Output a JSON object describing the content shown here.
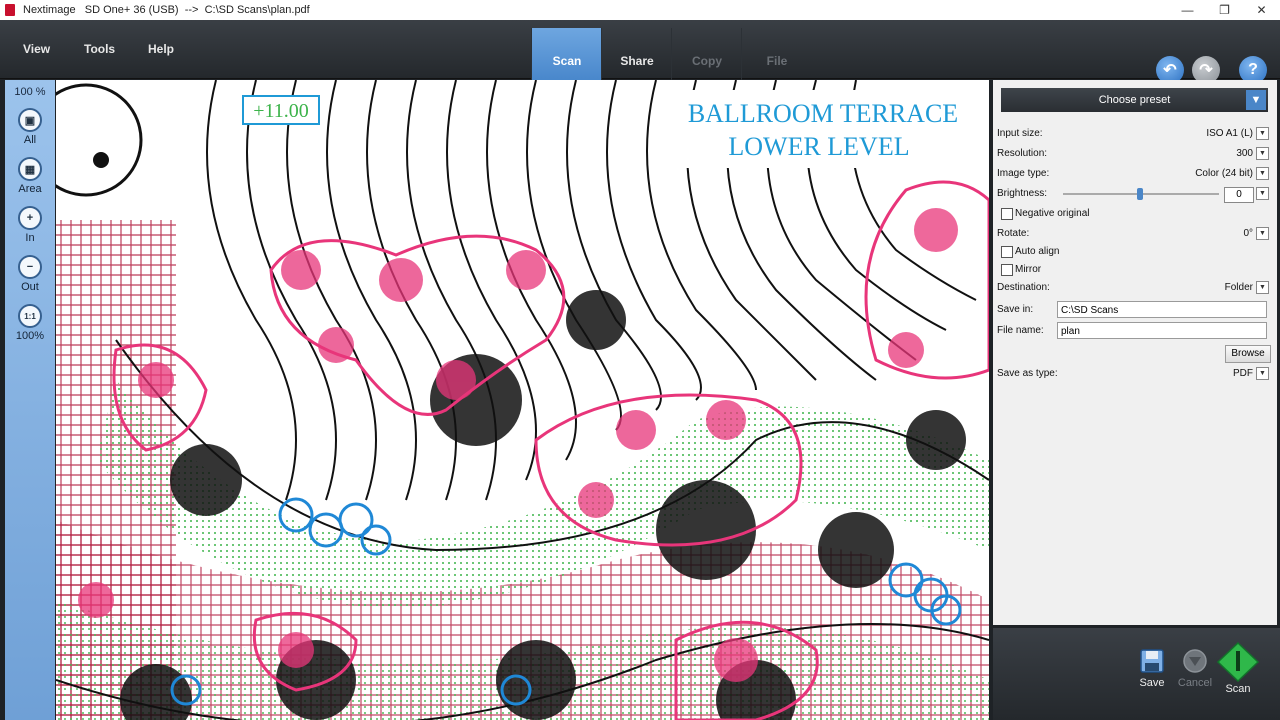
{
  "window": {
    "title": "Nextimage   SD One+ 36 (USB)  -->  C:\\SD Scans\\plan.pdf",
    "controls": [
      "minimize-icon",
      "restore-icon",
      "close-icon"
    ]
  },
  "menu": {
    "view": "View",
    "tools": "Tools",
    "help": "Help"
  },
  "tabs": [
    {
      "label": "Scan",
      "state": "active"
    },
    {
      "label": "Share",
      "state": "enabled"
    },
    {
      "label": "Copy",
      "state": "disabled"
    },
    {
      "label": "File",
      "state": "disabled"
    }
  ],
  "nav_buttons": [
    "undo-icon",
    "redo-icon",
    "help-icon"
  ],
  "left_toolbar": {
    "zoom": "100 %",
    "tools": [
      {
        "label": "All",
        "icon": "zoom-all-icon"
      },
      {
        "label": "Area",
        "icon": "zoom-area-icon"
      },
      {
        "label": "In",
        "icon": "zoom-in-icon"
      },
      {
        "label": "Out",
        "icon": "zoom-out-icon"
      },
      {
        "label": "100%",
        "icon": "zoom-100-icon"
      }
    ]
  },
  "preview": {
    "title_line1": "BALLROOM TERRACE",
    "title_line2": "LOWER LEVEL",
    "elevation": "+11.00"
  },
  "settings": {
    "preset": "Choose preset",
    "input_size_label": "Input size:",
    "input_size_value": "ISO A1 (L)",
    "resolution_label": "Resolution:",
    "resolution_value": "300",
    "image_type_label": "Image type:",
    "image_type_value": "Color (24 bit)",
    "brightness_label": "Brightness:",
    "brightness_value": "0",
    "negative_label": "Negative original",
    "negative_checked": false,
    "rotate_label": "Rotate:",
    "rotate_value": "0°",
    "auto_align_label": "Auto align",
    "auto_align_checked": false,
    "mirror_label": "Mirror",
    "mirror_checked": false,
    "destination_label": "Destination:",
    "destination_value": "Folder",
    "save_in_label": "Save in:",
    "save_in_value": "C:\\SD Scans",
    "file_name_label": "File name:",
    "file_name_value": "plan",
    "browse_label": "Browse",
    "save_as_label": "Save as type:",
    "save_as_value": "PDF"
  },
  "actions": {
    "save": "Save",
    "cancel": "Cancel",
    "scan": "Scan"
  },
  "colors": {
    "accent": "#4a86c8",
    "scan_green": "#2fb84a",
    "title_blue": "#1f9ad6",
    "plant_pink": "#e8357a"
  }
}
